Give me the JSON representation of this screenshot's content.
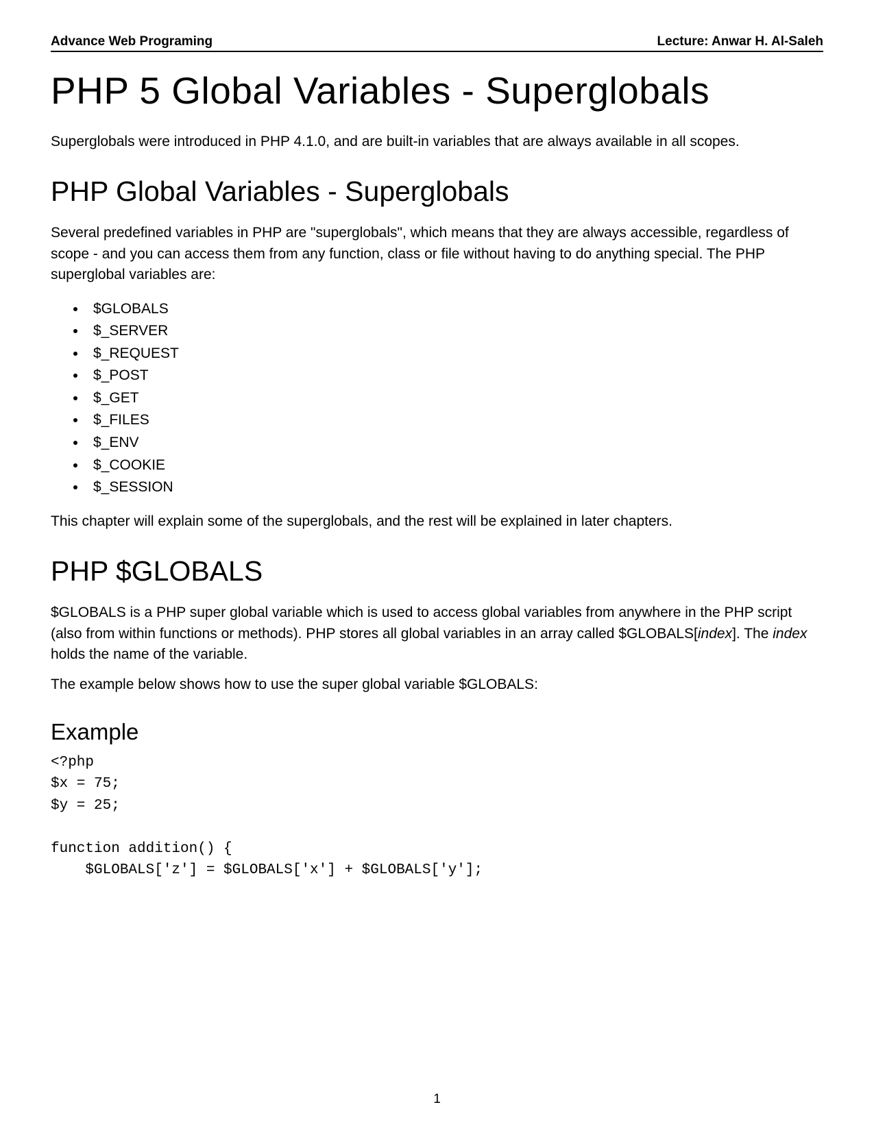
{
  "header": {
    "left": "Advance Web Programing",
    "right": "Lecture: Anwar H. Al-Saleh"
  },
  "title": "PHP 5 Global Variables - Superglobals",
  "intro": "Superglobals were introduced in PHP 4.1.0, and are built-in variables that are always available in all scopes.",
  "section1": {
    "heading": "PHP Global Variables - Superglobals",
    "para": "Several predefined variables in PHP are \"superglobals\", which means that they are always accessible, regardless of scope - and you can access them from any function, class or file without having to do anything special. The PHP superglobal variables are:",
    "list": [
      "$GLOBALS",
      "$_SERVER",
      "$_REQUEST",
      "$_POST",
      "$_GET",
      "$_FILES",
      "$_ENV",
      "$_COOKIE",
      "$_SESSION"
    ],
    "after": "This chapter will explain some of the superglobals, and the rest will be explained in later chapters."
  },
  "section2": {
    "heading": "PHP $GLOBALS",
    "para1_a": "$GLOBALS is a PHP super global variable which is used to access global variables from anywhere in the PHP script (also from within functions or methods). PHP stores all global variables in an array called $GLOBALS[",
    "para1_index1": "index",
    "para1_b": "]. The ",
    "para1_index2": "index",
    "para1_c": " holds the name of the variable.",
    "para2": "The example below shows how to use the super global variable $GLOBALS:",
    "example_heading": "Example",
    "code": "<?php\n$x = 75;\n$y = 25;\n\nfunction addition() {\n    $GLOBALS['z'] = $GLOBALS['x'] + $GLOBALS['y'];"
  },
  "page_number": "1"
}
